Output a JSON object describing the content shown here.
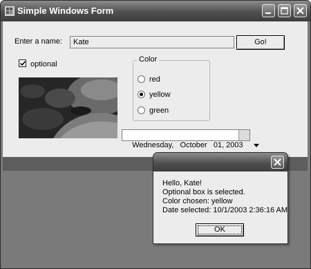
{
  "window": {
    "title": "Simple Windows Form"
  },
  "form": {
    "name_label": "Enter a name:",
    "name_value": "Kate",
    "go_button": "Go!",
    "optional_label": "optional",
    "optional_checked": true,
    "color_group_title": "Color",
    "color_options": [
      {
        "label": "red",
        "checked": false
      },
      {
        "label": "yellow",
        "checked": true
      },
      {
        "label": "green",
        "checked": false
      }
    ],
    "date_value": "Wednesday,   October   01, 2003"
  },
  "dialog": {
    "lines": [
      "Hello, Kate!",
      "Optional box is selected.",
      "Color chosen: yellow",
      "Date selected: 10/1/2003 2:36:16 AM"
    ],
    "ok_button": "OK"
  },
  "icons": {
    "app": "app-icon",
    "minimize": "minimize-icon",
    "maximize": "maximize-icon",
    "close": "close-icon",
    "dropdown": "chevron-down-icon",
    "checkmark": "checkmark-icon"
  },
  "colors": {
    "titlebar_dark": "#3e3e3e",
    "form_background": "#ececec",
    "desktop_gray": "#7a7a7a"
  }
}
